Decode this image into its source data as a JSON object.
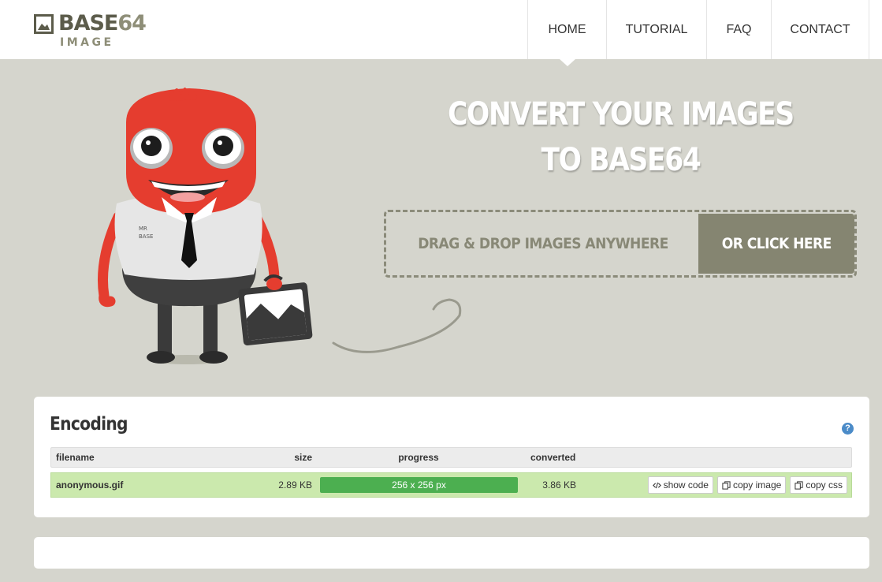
{
  "brand": {
    "name_main": "BASE",
    "name_accent": "64",
    "name_sub": "IMAGE",
    "icon": "image-icon"
  },
  "nav": {
    "items": [
      {
        "label": "HOME",
        "active": true
      },
      {
        "label": "TUTORIAL"
      },
      {
        "label": "FAQ"
      },
      {
        "label": "CONTACT"
      }
    ]
  },
  "hero": {
    "title_line1": "CONVERT YOUR IMAGES",
    "title_line2": "TO BASE64",
    "drop_text": "DRAG & DROP IMAGES ANYWHERE",
    "click_label": "OR CLICK HERE",
    "mascot_badge_line1": "MR",
    "mascot_badge_line2": "BASE"
  },
  "encoding": {
    "title": "Encoding",
    "help_label": "?",
    "columns": {
      "filename": "filename",
      "size": "size",
      "progress": "progress",
      "converted": "converted"
    },
    "rows": [
      {
        "filename": "anonymous.gif",
        "size": "2.89 KB",
        "progress_text": "256 x 256 px",
        "progress_fraction": 1.0,
        "converted": "3.86 KB",
        "actions": {
          "show_code": "show code",
          "copy_image": "copy image",
          "copy_css": "copy css"
        }
      }
    ]
  },
  "colors": {
    "background": "#d5d5cd",
    "accent": "#858571",
    "progress": "#4caf50",
    "row_success": "#cbe9ad",
    "mascot_red": "#e53d2f",
    "help": "#4b8bc8"
  }
}
